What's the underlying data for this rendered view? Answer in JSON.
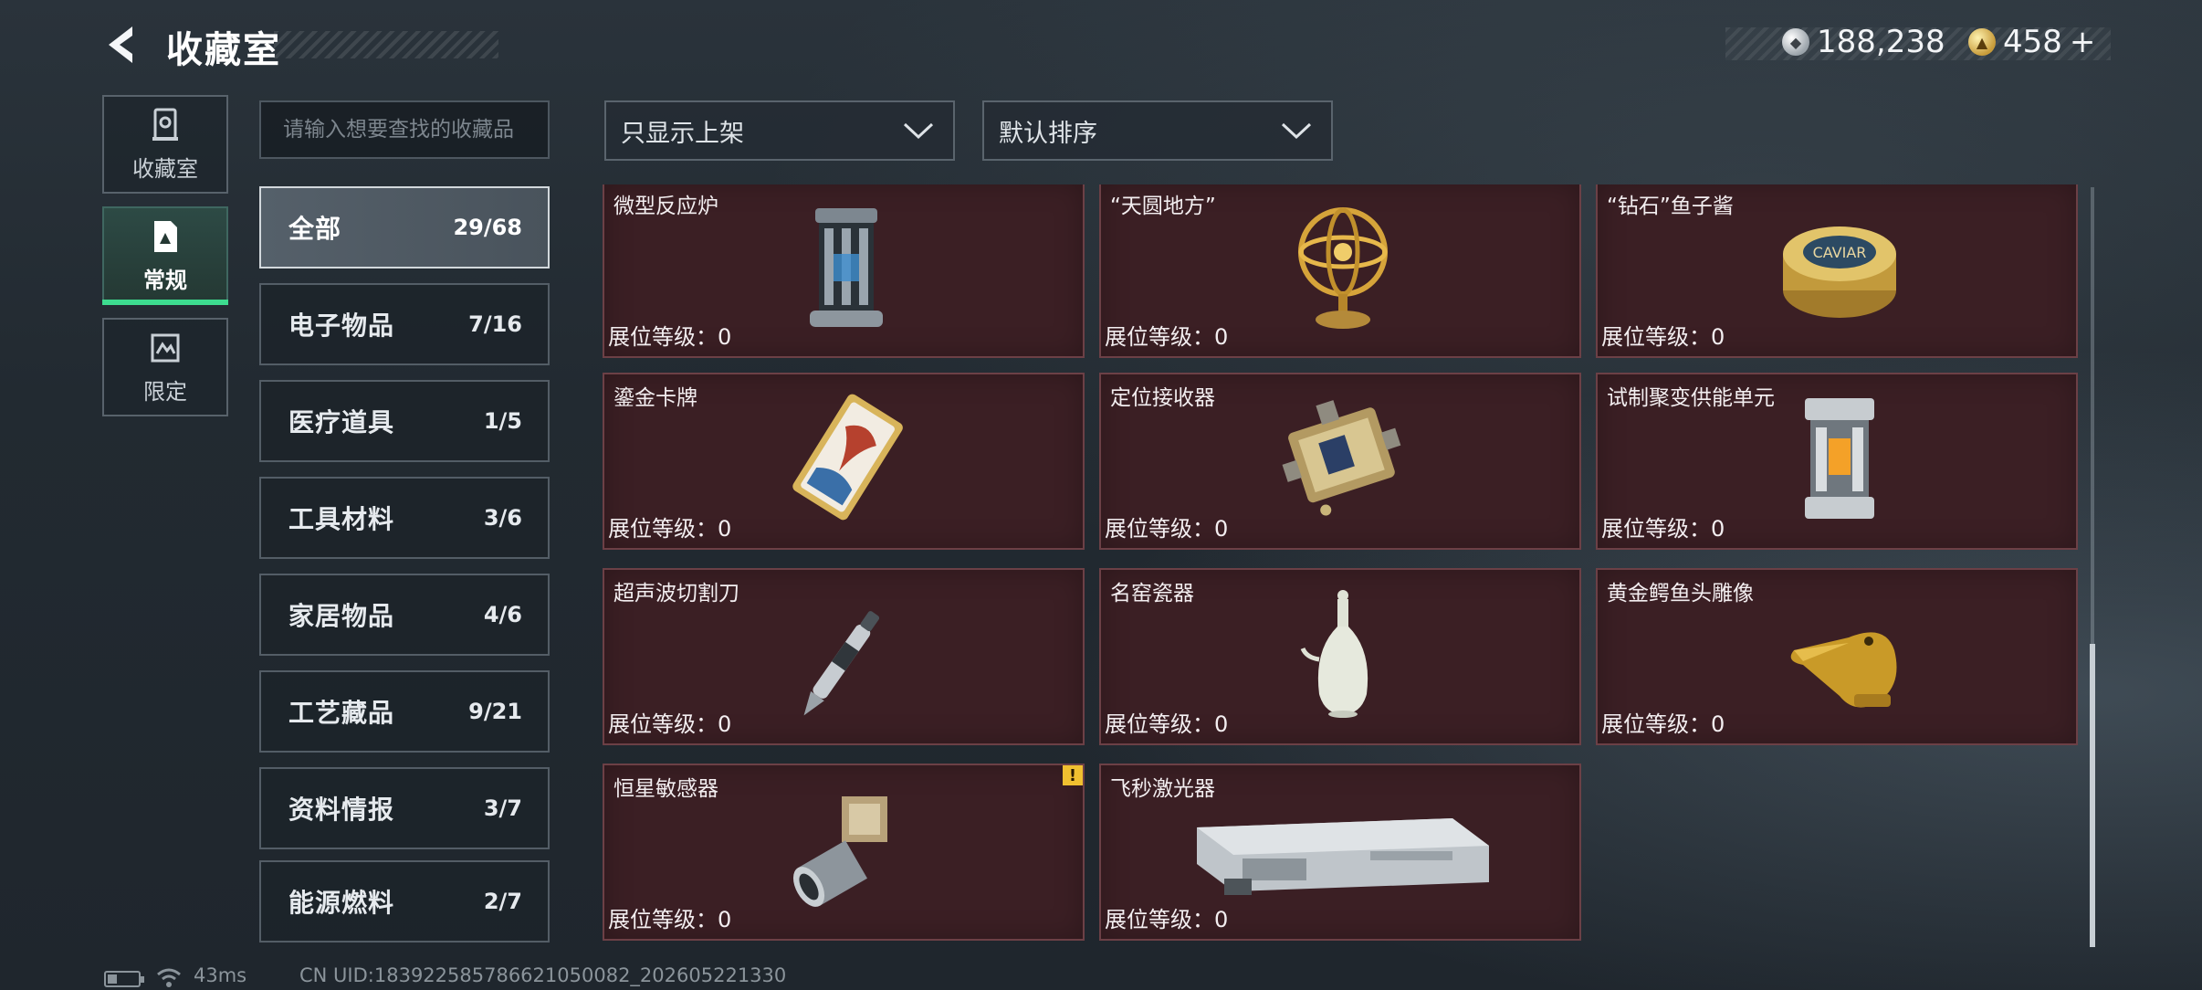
{
  "header": {
    "title": "收藏室",
    "currency": [
      {
        "icon": "silver-coin-icon",
        "value": "188,238"
      },
      {
        "icon": "gold-coin-icon",
        "value": "458",
        "plus": "+"
      }
    ]
  },
  "leftnav": [
    {
      "label": "收藏室",
      "icon": "collection-icon",
      "active": false
    },
    {
      "label": "常规",
      "icon": "regular-icon",
      "active": true
    },
    {
      "label": "限定",
      "icon": "limited-icon",
      "active": false
    }
  ],
  "search": {
    "placeholder": "请输入想要查找的收藏品"
  },
  "filters": {
    "shelf": "只显示上架",
    "sort": "默认排序"
  },
  "categories": [
    {
      "name": "全部",
      "count": "29/68",
      "active": true
    },
    {
      "name": "电子物品",
      "count": "7/16",
      "active": false
    },
    {
      "name": "医疗道具",
      "count": "1/5",
      "active": false
    },
    {
      "name": "工具材料",
      "count": "3/6",
      "active": false
    },
    {
      "name": "家居物品",
      "count": "4/6",
      "active": false
    },
    {
      "name": "工艺藏品",
      "count": "9/21",
      "active": false
    },
    {
      "name": "资料情报",
      "count": "3/7",
      "active": false
    },
    {
      "name": "能源燃料",
      "count": "2/7",
      "active": false
    }
  ],
  "items": [
    {
      "name": "微型反应炉",
      "level": "展位等级：0",
      "icon": "reactor-icon"
    },
    {
      "name": "“天圆地方”",
      "level": "展位等级：0",
      "icon": "armillary-sphere-icon"
    },
    {
      "name": "“钻石”鱼子酱",
      "level": "展位等级：0",
      "icon": "caviar-tin-icon",
      "tin_text": "CAVIAR"
    },
    {
      "name": "鎏金卡牌",
      "level": "展位等级：0",
      "icon": "gilded-card-icon"
    },
    {
      "name": "定位接收器",
      "level": "展位等级：0",
      "icon": "receiver-icon"
    },
    {
      "name": "试制聚变供能单元",
      "level": "展位等级：0",
      "icon": "fusion-cell-icon"
    },
    {
      "name": "超声波切割刀",
      "level": "展位等级：0",
      "icon": "ultrasonic-knife-icon"
    },
    {
      "name": "名窑瓷器",
      "level": "展位等级：0",
      "icon": "porcelain-vase-icon"
    },
    {
      "name": "黄金鳄鱼头雕像",
      "level": "展位等级：0",
      "icon": "gold-crocodile-icon"
    },
    {
      "name": "恒星敏感器",
      "level": "展位等级：0",
      "icon": "star-sensor-icon",
      "badge": "!"
    },
    {
      "name": "飞秒激光器",
      "level": "展位等级：0",
      "icon": "femtosecond-laser-icon"
    }
  ],
  "status": {
    "ping": "43ms",
    "uid": "CN UID:18392258578662105008​2_202605221330"
  },
  "colors": {
    "accent": "#3ddc8f",
    "card_bg": "#3b1f24",
    "card_border": "#6c4046",
    "badge": "#f0c030"
  }
}
